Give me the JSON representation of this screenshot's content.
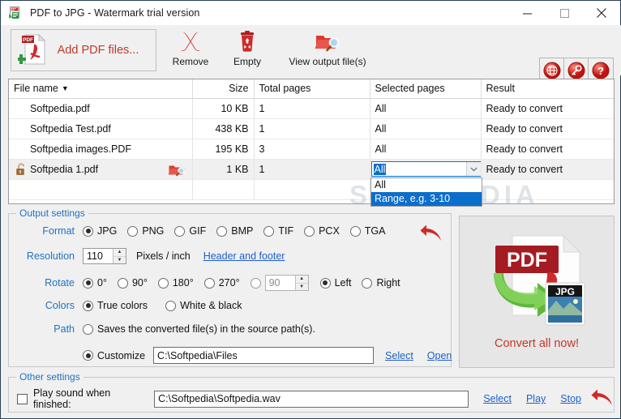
{
  "window": {
    "title": "PDF to JPG - Watermark trial version",
    "app_icon": "pdf-app-icon",
    "minimize": "minimize-icon",
    "maximize": "maximize-icon",
    "close": "close-icon"
  },
  "toolbar": {
    "add_files_label": "Add PDF files...",
    "buttons": [
      {
        "label": "Remove",
        "icon": "red-x-icon"
      },
      {
        "label": "Empty",
        "icon": "trash-can-icon"
      },
      {
        "label": "View output file(s)",
        "icon": "folder-search-icon"
      }
    ],
    "right_buttons": [
      {
        "icon": "globe-icon"
      },
      {
        "icon": "key-icon"
      },
      {
        "icon": "help-question-icon"
      }
    ]
  },
  "file_table": {
    "columns": [
      "File name",
      "Size",
      "Total pages",
      "Selected pages",
      "Result"
    ],
    "sort_indicator": "▼",
    "rows": [
      {
        "name": "Softpedia.pdf",
        "size": "10 KB",
        "total_pages": "1",
        "selected_pages": "All",
        "result": "Ready to convert",
        "locked": false,
        "selected": false
      },
      {
        "name": "Softpedia Test.pdf",
        "size": "438 KB",
        "total_pages": "1",
        "selected_pages": "All",
        "result": "Ready to convert",
        "locked": false,
        "selected": false
      },
      {
        "name": "Softpedia images.PDF",
        "size": "195 KB",
        "total_pages": "3",
        "selected_pages": "All",
        "result": "Ready to convert",
        "locked": false,
        "selected": false
      },
      {
        "name": "Softpedia 1.pdf",
        "size": "1 KB",
        "total_pages": "1",
        "selected_pages": "All",
        "result": "Ready to convert",
        "locked": true,
        "selected": true
      }
    ]
  },
  "pages_dropdown": {
    "value": "All",
    "open": true,
    "options": [
      {
        "label": "All",
        "highlighted": false
      },
      {
        "label": "Range, e.g. 3-10",
        "highlighted": true
      }
    ]
  },
  "watermark_text": "SOFTPEDIA",
  "output_settings": {
    "legend": "Output settings",
    "format": {
      "label": "Format",
      "options": [
        "JPG",
        "PNG",
        "GIF",
        "BMP",
        "TIF",
        "PCX",
        "TGA"
      ],
      "selected": "JPG"
    },
    "resolution": {
      "label": "Resolution",
      "value": "110",
      "unit": "Pixels / inch",
      "header_footer_link": "Header and footer"
    },
    "rotate": {
      "label": "Rotate",
      "options": [
        "0°",
        "90°",
        "180°",
        "270°"
      ],
      "selected": "0°",
      "custom_value": "90",
      "custom_selected": false,
      "direction_options": [
        "Left",
        "Right"
      ],
      "direction_selected": "Left"
    },
    "colors": {
      "label": "Colors",
      "options": [
        "True colors",
        "White & black"
      ],
      "selected": "True colors"
    },
    "path": {
      "label": "Path",
      "source_option": "Saves the converted file(s) in the source path(s).",
      "customize_option": "Customize",
      "selected": "Customize",
      "customize_value": "C:\\Softpedia\\Files",
      "select_link": "Select",
      "open_link": "Open"
    },
    "reset_icon": "red-undo-arrow-icon"
  },
  "other_settings": {
    "legend": "Other settings",
    "play_sound_label": "Play sound when finished:",
    "play_sound_checked": false,
    "sound_path": "C:\\Softpedia\\Softpedia.wav",
    "select_link": "Select",
    "play_link": "Play",
    "stop_link": "Stop",
    "reset_icon": "red-undo-arrow-icon"
  },
  "convert_panel": {
    "label": "Convert all now!",
    "source_badge": "PDF",
    "target_badge": "JPG",
    "icon": "pdf-to-jpg-convert-icon"
  },
  "colors": {
    "accent_red": "#c0392b",
    "label_blue": "#1f72c4",
    "link_blue": "#1f5fcc",
    "selection_blue": "#0b6ecb",
    "window_bg": "#f0f0f0"
  }
}
